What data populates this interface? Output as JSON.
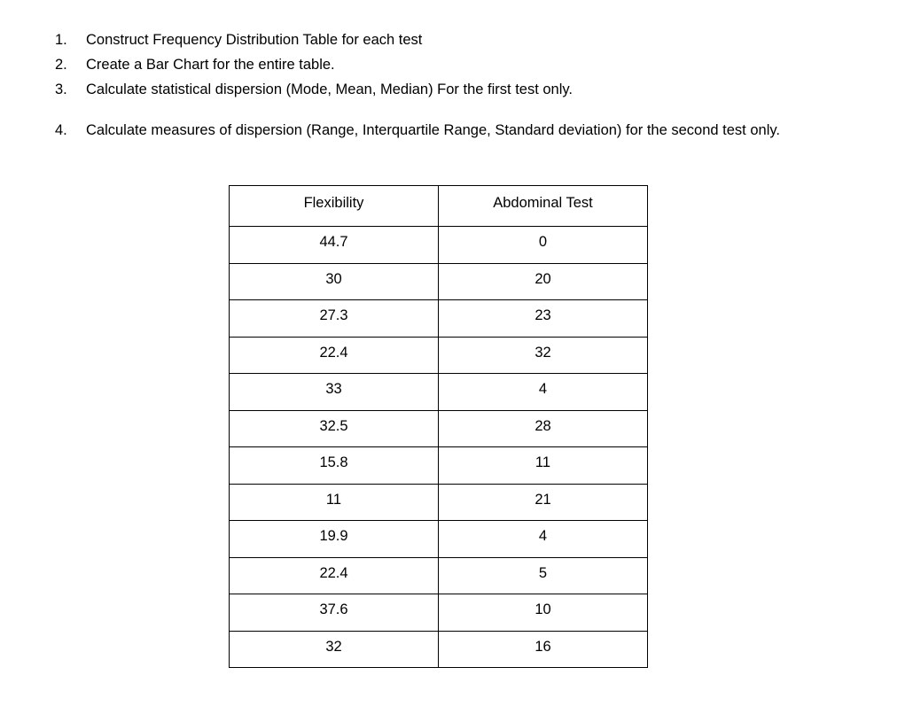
{
  "instructions": [
    {
      "number": "1.",
      "text": "Construct Frequency Distribution Table for each test",
      "extra_space_before": false
    },
    {
      "number": "2.",
      "text": "Create a Bar Chart for the entire table.",
      "extra_space_before": false
    },
    {
      "number": "3.",
      "text": "Calculate statistical dispersion (Mode, Mean, Median) For the first test only.",
      "extra_space_before": false
    },
    {
      "number": "4.",
      "text": "Calculate measures of dispersion (Range, Interquartile Range, Standard deviation) for the second test only.",
      "extra_space_before": true
    }
  ],
  "table": {
    "columns": [
      "Flexibility",
      "Abdominal Test"
    ],
    "rows": [
      [
        "44.7",
        "0"
      ],
      [
        "30",
        "20"
      ],
      [
        "27.3",
        "23"
      ],
      [
        "22.4",
        "32"
      ],
      [
        "33",
        "4"
      ],
      [
        "32.5",
        "28"
      ],
      [
        "15.8",
        "11"
      ],
      [
        "11",
        "21"
      ],
      [
        "19.9",
        "4"
      ],
      [
        "22.4",
        "5"
      ],
      [
        "37.6",
        "10"
      ],
      [
        "32",
        "16"
      ]
    ]
  }
}
